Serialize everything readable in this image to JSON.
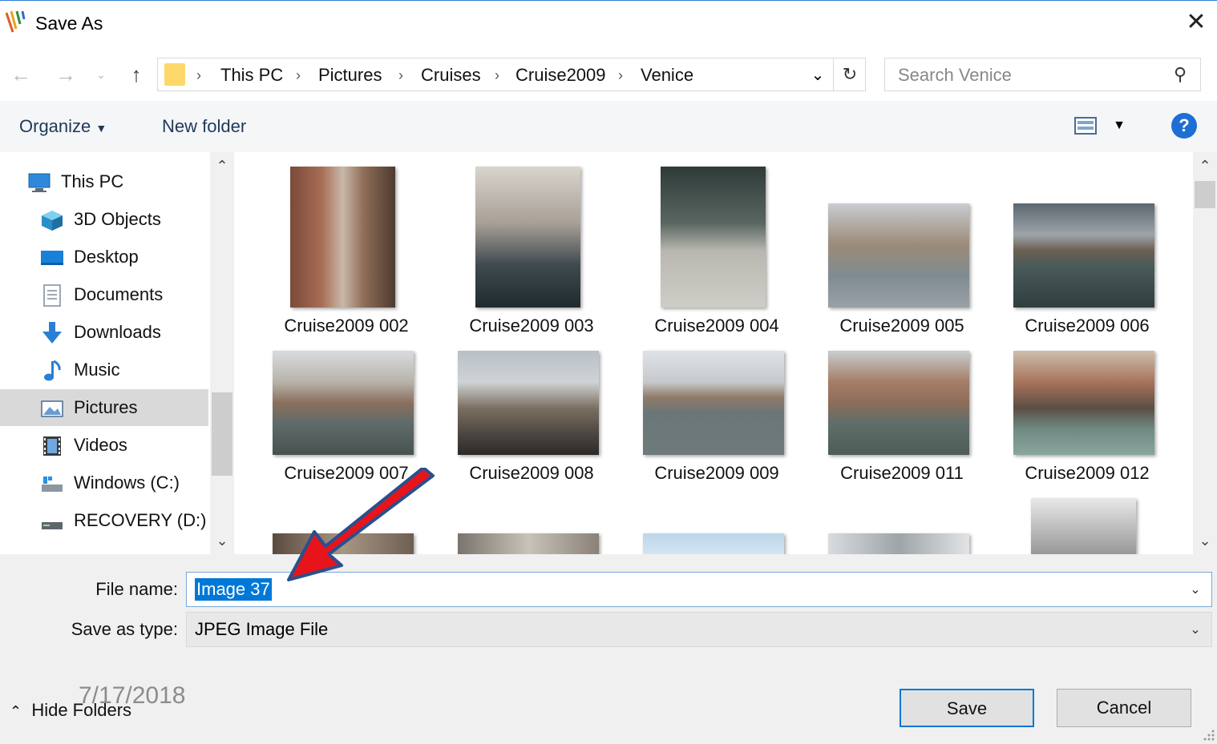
{
  "window": {
    "title": "Save As"
  },
  "address": {
    "crumbs": [
      "This PC",
      "Pictures",
      "Cruises",
      "Cruise2009",
      "Venice"
    ]
  },
  "search": {
    "placeholder": "Search Venice"
  },
  "toolbar": {
    "organize": "Organize",
    "new_folder": "New folder",
    "help": "?"
  },
  "nav": {
    "items": [
      {
        "label": "This PC",
        "icon": "computer-icon"
      },
      {
        "label": "3D Objects",
        "icon": "cube-icon"
      },
      {
        "label": "Desktop",
        "icon": "desktop-icon"
      },
      {
        "label": "Documents",
        "icon": "document-icon"
      },
      {
        "label": "Downloads",
        "icon": "download-arrow-icon"
      },
      {
        "label": "Music",
        "icon": "music-note-icon"
      },
      {
        "label": "Pictures",
        "icon": "pictures-icon"
      },
      {
        "label": "Videos",
        "icon": "film-icon"
      },
      {
        "label": "Windows (C:)",
        "icon": "drive-icon"
      },
      {
        "label": "RECOVERY (D:)",
        "icon": "drive-icon"
      }
    ],
    "selected": "Pictures"
  },
  "files": {
    "items": [
      "Cruise2009 002",
      "Cruise2009 003",
      "Cruise2009 004",
      "Cruise2009 005",
      "Cruise2009 006",
      "Cruise2009 007",
      "Cruise2009 008",
      "Cruise2009 009",
      "Cruise2009 011",
      "Cruise2009 012"
    ]
  },
  "form": {
    "file_name_label": "File name:",
    "file_name_value": "Image 37",
    "save_type_label": "Save as type:",
    "save_type_value": "JPEG Image File"
  },
  "buttons": {
    "save": "Save",
    "cancel": "Cancel",
    "hide_folders": "Hide Folders"
  },
  "watermark": {
    "date": "7/17/2018"
  },
  "colors": {
    "accent": "#0078d7",
    "selection": "#d9d9d9",
    "arrow": "#e8141b",
    "help": "#1d6fd4"
  }
}
